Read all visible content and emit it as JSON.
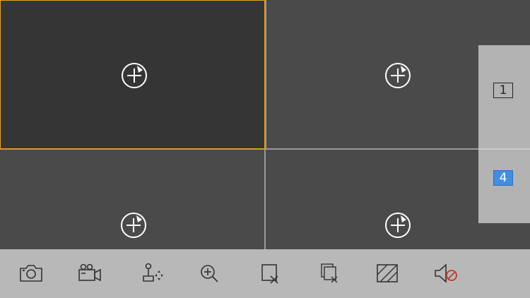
{
  "layout_selector": {
    "options": [
      {
        "label": "1",
        "selected": false
      },
      {
        "label": "4",
        "selected": true
      }
    ]
  },
  "panes": [
    {
      "icon": "add-camera-icon",
      "selected": true
    },
    {
      "icon": "add-camera-icon",
      "selected": false
    },
    {
      "icon": "add-camera-icon",
      "selected": false
    },
    {
      "icon": "add-camera-icon",
      "selected": false
    }
  ],
  "toolbar": {
    "tools": [
      "snapshot-camera-icon",
      "record-video-icon",
      "ptz-control-icon",
      "digital-zoom-icon",
      "close-window-icon",
      "close-all-windows-icon",
      "image-quality-icon",
      "audio-mute-icon"
    ]
  },
  "colors": {
    "selection_border": "#e8a317",
    "selected_layout_bg": "#3f8ee0",
    "mute_accent": "#c0392b"
  }
}
